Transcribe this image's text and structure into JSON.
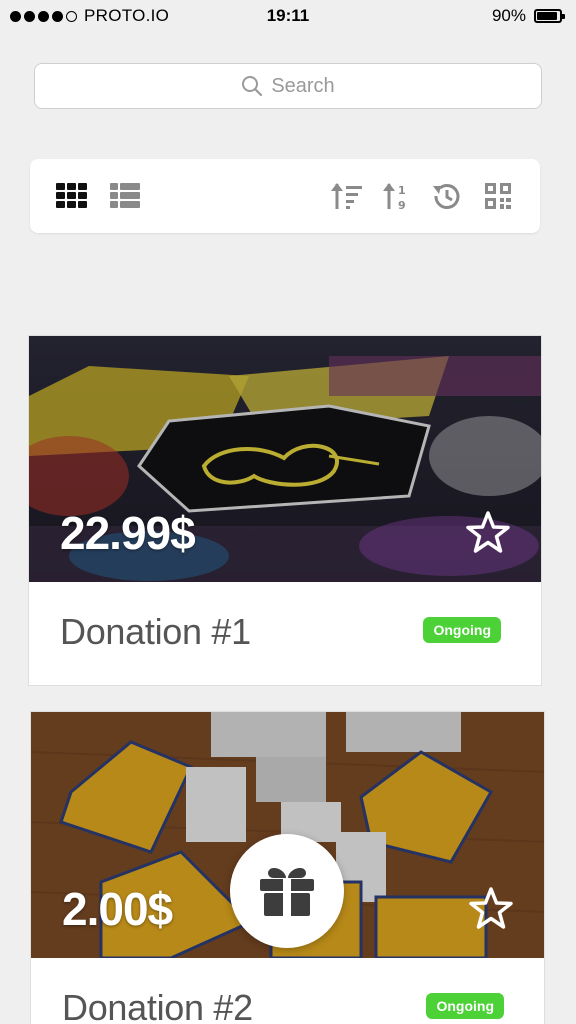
{
  "status_bar": {
    "carrier": "PROTO.IO",
    "time": "19:11",
    "battery": "90%",
    "battery_level": 0.9,
    "signal_bars": 4,
    "signal_total": 5
  },
  "search": {
    "placeholder": "Search",
    "icon": "search-icon"
  },
  "toolbar": {
    "left_icons": [
      "grid-view-icon",
      "list-view-icon"
    ],
    "right_icons": [
      "sort-descending-icon",
      "sort-numeric-icon",
      "history-icon",
      "qr-code-icon"
    ]
  },
  "donations": [
    {
      "price": "22.99$",
      "title": "Donation #1",
      "status": "Ongoing",
      "favorite_icon": "star-outline-icon"
    },
    {
      "price": "2.00$",
      "title": "Donation #2",
      "status": "Ongoing",
      "favorite_icon": "star-outline-icon"
    }
  ],
  "fab": {
    "icon": "gift-icon"
  },
  "colors": {
    "background": "#efefef",
    "badge_green": "#4cd137",
    "text_dark": "#555555",
    "icon_gray": "#888888"
  }
}
